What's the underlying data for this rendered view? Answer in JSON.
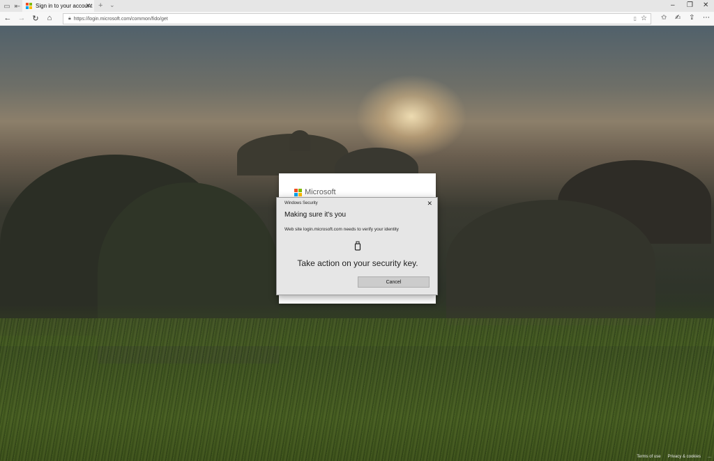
{
  "browser": {
    "tab": {
      "title": "Sign in to your account"
    },
    "address": {
      "url": "https://login.microsoft.com/common/fido/get"
    }
  },
  "signin": {
    "brand": "Microsoft"
  },
  "dialog": {
    "window_title": "Windows Security",
    "heading": "Making sure it's you",
    "message": "Web site login.microsoft.com needs to verify your identity",
    "instruction": "Take action on your security key.",
    "cancel_label": "Cancel",
    "icon": "usb-security-key-icon"
  },
  "footer": {
    "terms": "Terms of use",
    "privacy": "Privacy & cookies",
    "more": "..."
  },
  "colors": {
    "ms_red": "#f25022",
    "ms_green": "#7fba00",
    "ms_blue": "#00a4ef",
    "ms_yellow": "#ffb900",
    "dialog_bg": "#e6e6e6",
    "button_bg": "#cccccc"
  }
}
